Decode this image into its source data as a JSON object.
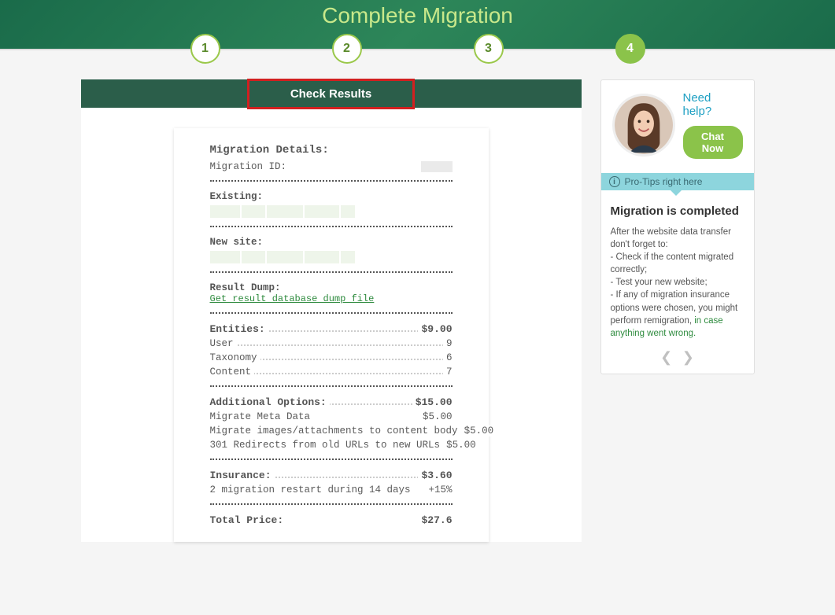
{
  "hero": {
    "title": "Complete Migration"
  },
  "steps": [
    "1",
    "2",
    "3",
    "4"
  ],
  "panel": {
    "header": "Check Results"
  },
  "receipt": {
    "title": "Migration Details:",
    "migration_id_label": "Migration ID:",
    "existing_label": "Existing:",
    "newsite_label": "New site:",
    "result_dump_label": "Result Dump:",
    "dump_link": "Get result database dump file",
    "entities": {
      "label": "Entities:",
      "total": "$9.00",
      "items": [
        {
          "name": "User",
          "value": "9"
        },
        {
          "name": "Taxonomy",
          "value": "6"
        },
        {
          "name": "Content",
          "value": "7"
        }
      ]
    },
    "options": {
      "label": "Additional Options:",
      "total": "$15.00",
      "items": [
        {
          "name": "Migrate Meta Data",
          "value": "$5.00"
        },
        {
          "name": "Migrate images/attachments to content body",
          "value": "$5.00"
        },
        {
          "name": "301 Redirects from old URLs to new URLs",
          "value": "$5.00"
        }
      ]
    },
    "insurance": {
      "label": "Insurance:",
      "total": "$3.60",
      "line": "2 migration restart during 14 days",
      "pct": "+15%"
    },
    "total": {
      "label": "Total Price:",
      "value": "$27.6"
    }
  },
  "side": {
    "need_help": "Need help?",
    "chat_btn": "Chat Now",
    "tips_bar": "Pro-Tips right here",
    "tips_title": "Migration is completed",
    "tips_intro": "After the website data transfer don't forget to:",
    "tips_lines": [
      "- Check if the content migrated correctly;",
      "- Test your new website;",
      "- If any of migration insurance options were chosen, you might perform remigration, "
    ],
    "tips_link": "in case anything went wrong."
  }
}
